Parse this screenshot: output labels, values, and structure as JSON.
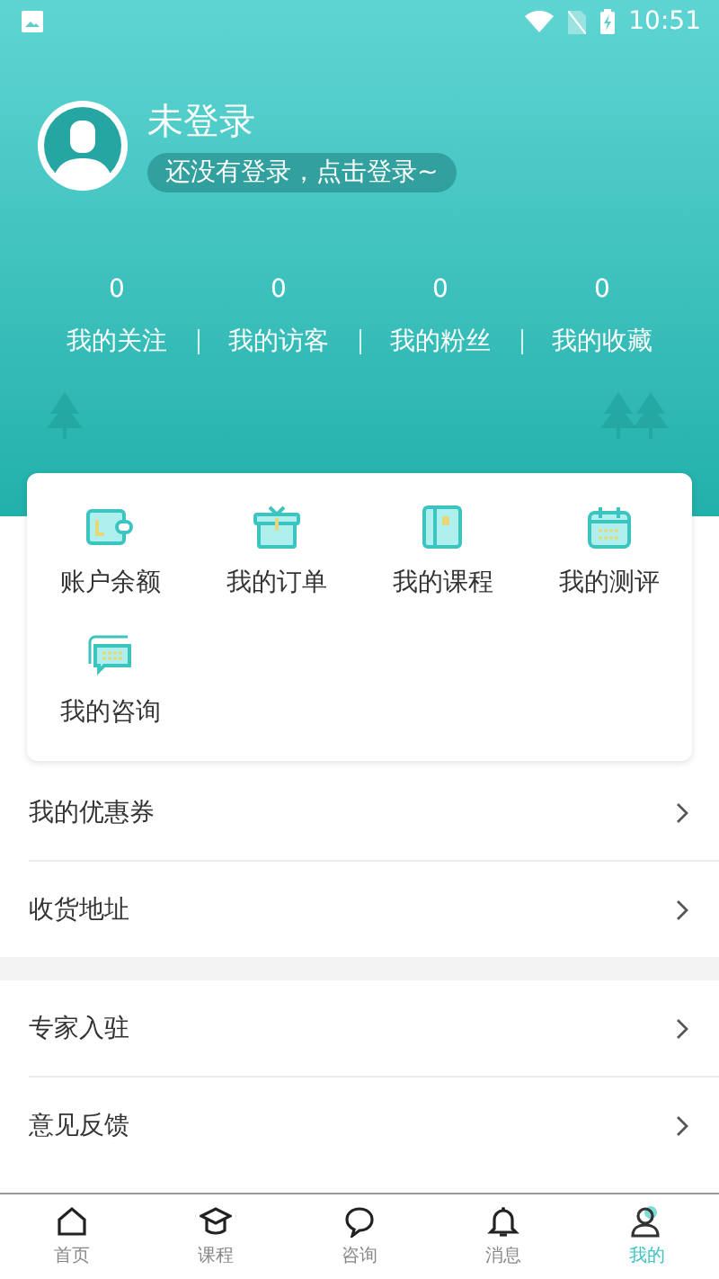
{
  "status_bar": {
    "time": "10:51"
  },
  "profile": {
    "name": "未登录",
    "login_hint": "还没有登录，点击登录~"
  },
  "stats": [
    {
      "value": "0",
      "label": "我的关注"
    },
    {
      "value": "0",
      "label": "我的访客"
    },
    {
      "value": "0",
      "label": "我的粉丝"
    },
    {
      "value": "0",
      "label": "我的收藏"
    }
  ],
  "shortcuts": [
    {
      "label": "账户余额"
    },
    {
      "label": "我的订单"
    },
    {
      "label": "我的课程"
    },
    {
      "label": "我的测评"
    },
    {
      "label": "我的咨询"
    }
  ],
  "menu_groups": [
    [
      {
        "label": "我的优惠券"
      },
      {
        "label": "收货地址"
      }
    ],
    [
      {
        "label": "专家入驻"
      },
      {
        "label": "意见反馈"
      }
    ]
  ],
  "bottom_nav": [
    {
      "label": "首页",
      "selected": false
    },
    {
      "label": "课程",
      "selected": false
    },
    {
      "label": "咨询",
      "selected": false
    },
    {
      "label": "消息",
      "selected": false
    },
    {
      "label": "我的",
      "selected": true
    }
  ]
}
